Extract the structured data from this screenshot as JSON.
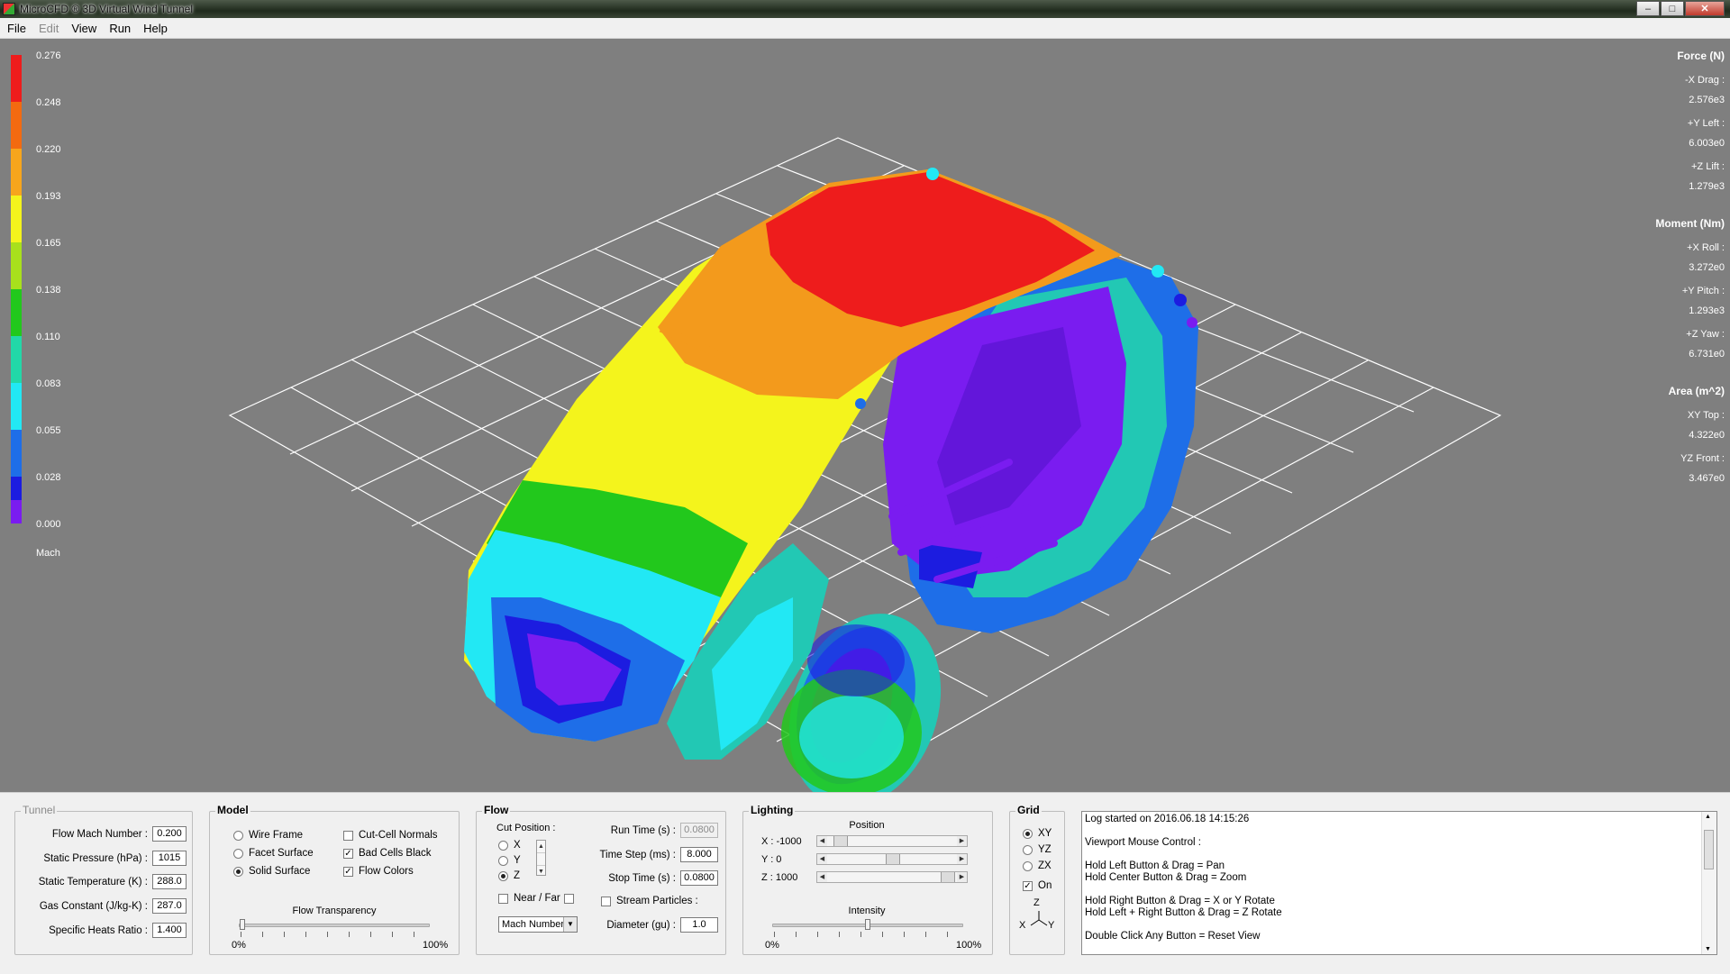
{
  "window": {
    "title": "MicroCFD ® 3D Virtual Wind Tunnel",
    "controls": {
      "minimize": "–",
      "maximize": "□",
      "close": "✕"
    }
  },
  "menu": [
    {
      "label": "File",
      "enabled": true
    },
    {
      "label": "Edit",
      "enabled": false
    },
    {
      "label": "View",
      "enabled": true
    },
    {
      "label": "Run",
      "enabled": true
    },
    {
      "label": "Help",
      "enabled": true
    }
  ],
  "legend": {
    "labels": [
      "0.276",
      "0.248",
      "0.220",
      "0.193",
      "0.165",
      "0.138",
      "0.110",
      "0.083",
      "0.055",
      "0.028",
      "0.000"
    ],
    "title": "Mach"
  },
  "stats": {
    "force_title": "Force (N)",
    "drag_label": "-X  Drag :",
    "drag_value": "2.576e3",
    "left_label": "+Y  Left :",
    "left_value": "6.003e0",
    "lift_label": "+Z  Lift :",
    "lift_value": "1.279e3",
    "moment_title": "Moment (Nm)",
    "roll_label": "+X  Roll :",
    "roll_value": "3.272e0",
    "pitch_label": "+Y  Pitch :",
    "pitch_value": "1.293e3",
    "yaw_label": "+Z  Yaw :",
    "yaw_value": "6.731e0",
    "area_title": "Area (m^2)",
    "top_label": "XY  Top :",
    "top_value": "4.322e0",
    "front_label": "YZ  Front :",
    "front_value": "3.467e0"
  },
  "tunnel": {
    "title": "Tunnel",
    "mach_label": "Flow Mach Number :",
    "mach_value": "0.200",
    "pressure_label": "Static Pressure (hPa) :",
    "pressure_value": "1015",
    "temp_label": "Static Temperature (K) :",
    "temp_value": "288.0",
    "gas_label": "Gas Constant (J/kg-K) :",
    "gas_value": "287.0",
    "heats_label": "Specific Heats Ratio :",
    "heats_value": "1.400"
  },
  "model": {
    "title": "Model",
    "wire_frame": "Wire Frame",
    "facet_surface": "Facet Surface",
    "solid_surface": "Solid Surface",
    "cut_cell_normals": "Cut-Cell Normals",
    "bad_cells_black": "Bad Cells Black",
    "flow_colors": "Flow Colors",
    "transparency_label": "Flow Transparency",
    "min_label": "0%",
    "max_label": "100%",
    "transparency_percent": 0
  },
  "flow": {
    "title": "Flow",
    "cut_position_label": "Cut Position :",
    "x_label": "X",
    "y_label": "Y",
    "z_label": "Z",
    "near_far_label": "Near / Far",
    "run_time_label": "Run Time (s) :",
    "run_time_value": "0.0800",
    "time_step_label": "Time Step (ms) :",
    "time_step_value": "8.000",
    "stop_time_label": "Stop Time (s) :",
    "stop_time_value": "0.0800",
    "stream_particles_label": "Stream Particles :",
    "diameter_label": "Diameter (gu) :",
    "diameter_value": "1.0",
    "variable_select": "Mach Number"
  },
  "lighting": {
    "title": "Lighting",
    "position_label": "Position",
    "x_label": "X : -1000",
    "y_label": "Y : 0",
    "z_label": "Z : 1000",
    "x_percent": 5,
    "y_percent": 50,
    "z_percent": 97,
    "intensity_label": "Intensity",
    "min_label": "0%",
    "max_label": "100%",
    "intensity_percent": 50
  },
  "grid": {
    "title": "Grid",
    "xy_label": "XY",
    "yz_label": "YZ",
    "zx_label": "ZX",
    "on_label": "On",
    "axis_z": "Z",
    "axis_x": "X",
    "axis_y": "Y"
  },
  "log": [
    "Log started on 2016.06.18 14:15:26",
    "",
    "Viewport Mouse Control :",
    "",
    "Hold Left Button & Drag  =  Pan",
    "Hold Center Button & Drag  =  Zoom",
    "",
    "Hold Right Button & Drag  =  X or Y Rotate",
    "Hold Left + Right Button & Drag  =  Z Rotate",
    "",
    "Double Click Any Button  =  Reset View"
  ],
  "colors": {
    "red": "#ee1c1c",
    "orange": "#f39a1c",
    "yellow": "#f4f41c",
    "green": "#22c81c",
    "cyan": "#22e8f4",
    "blue": "#1e6ee8",
    "darkblue": "#1c1ce0",
    "violet": "#7a1cf0",
    "teal": "#22c8b4",
    "grid": "#ffffff",
    "viewport_bg": "#7f7f7f"
  }
}
